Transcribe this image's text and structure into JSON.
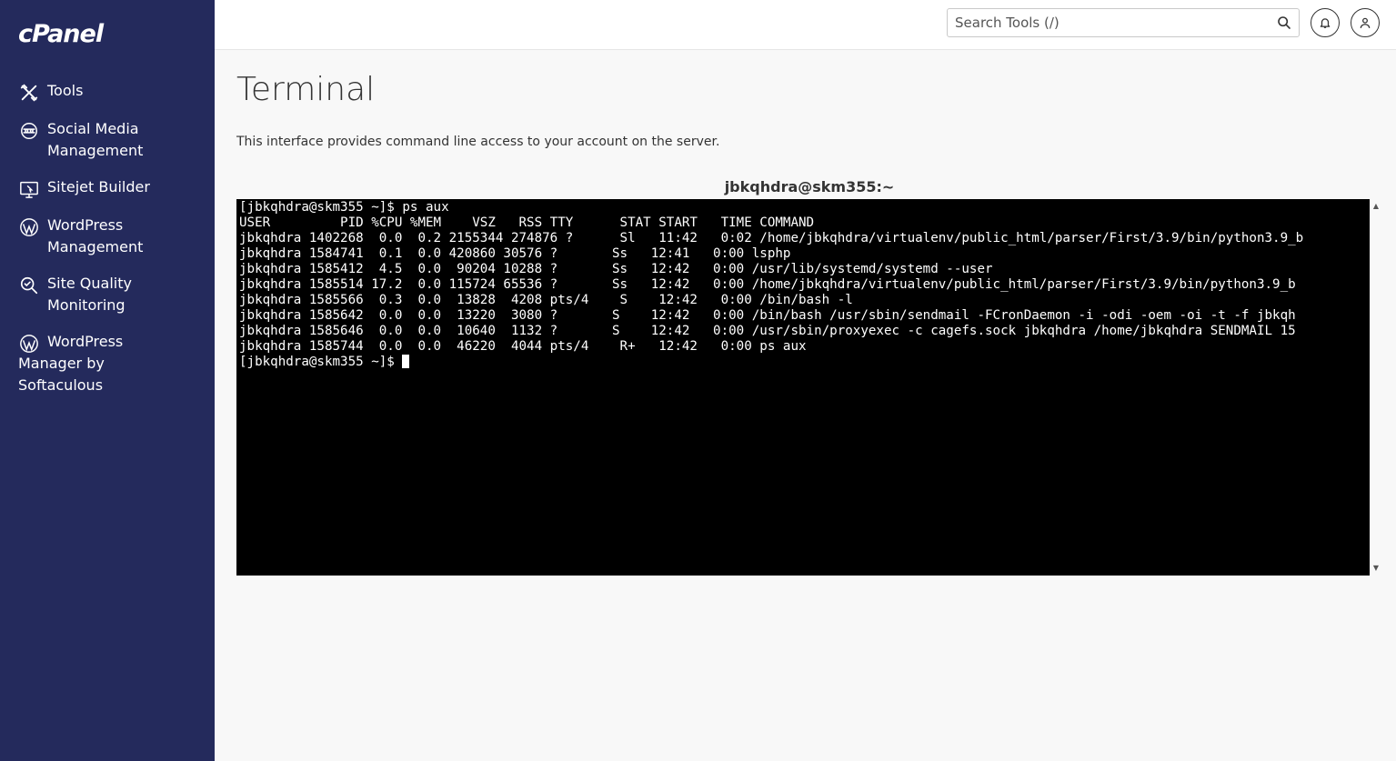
{
  "sidebar": {
    "logo": "cPanel",
    "items": [
      {
        "label": "Tools",
        "icon": "tools-icon"
      },
      {
        "label": "Social Media Management",
        "icon": "social-media-icon"
      },
      {
        "label": "Sitejet Builder",
        "icon": "sitejet-icon"
      },
      {
        "label": "WordPress Management",
        "icon": "wordpress-icon"
      },
      {
        "label": "Site Quality Monitoring",
        "icon": "site-quality-icon"
      },
      {
        "label": "WordPress Manager by Softaculous",
        "icon": "wordpress-icon"
      }
    ]
  },
  "header": {
    "search_placeholder": "Search Tools (/)",
    "icons": [
      "search-icon",
      "bell-icon",
      "user-icon"
    ]
  },
  "main": {
    "title": "Terminal",
    "description": "This interface provides command line access to your account on the server.",
    "terminal_title": "jbkqhdra@skm355:~",
    "terminal_lines": [
      "[jbkqhdra@skm355 ~]$ ps aux",
      "USER         PID %CPU %MEM    VSZ   RSS TTY      STAT START   TIME COMMAND",
      "jbkqhdra 1402268  0.0  0.2 2155344 274876 ?      Sl   11:42   0:02 /home/jbkqhdra/virtualenv/public_html/parser/First/3.9/bin/python3.9_b",
      "jbkqhdra 1584741  0.1  0.0 420860 30576 ?       Ss   12:41   0:00 lsphp",
      "jbkqhdra 1585412  4.5  0.0  90204 10288 ?       Ss   12:42   0:00 /usr/lib/systemd/systemd --user",
      "jbkqhdra 1585514 17.2  0.0 115724 65536 ?       Ss   12:42   0:00 /home/jbkqhdra/virtualenv/public_html/parser/First/3.9/bin/python3.9_b",
      "jbkqhdra 1585566  0.3  0.0  13828  4208 pts/4    S    12:42   0:00 /bin/bash -l",
      "jbkqhdra 1585642  0.0  0.0  13220  3080 ?       S    12:42   0:00 /bin/bash /usr/sbin/sendmail -FCronDaemon -i -odi -oem -oi -t -f jbkqh",
      "jbkqhdra 1585646  0.0  0.0  10640  1132 ?       S    12:42   0:00 /usr/sbin/proxyexec -c cagefs.sock jbkqhdra /home/jbkqhdra SENDMAIL 15",
      "jbkqhdra 1585744  0.0  0.0  46220  4044 pts/4    R+   12:42   0:00 ps aux"
    ],
    "prompt": "[jbkqhdra@skm355 ~]$ "
  },
  "colors": {
    "sidebar_bg": "#242a5c",
    "terminal_bg": "#000000",
    "terminal_fg": "#ffffff"
  }
}
